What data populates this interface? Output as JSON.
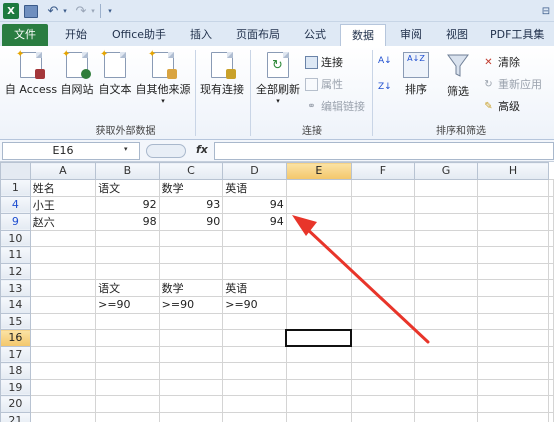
{
  "titlebar": {
    "app_icon": "X",
    "undo": "↶",
    "redo": "↷",
    "more": "▾",
    "drop": "▾",
    "right_text": "⊟"
  },
  "tabs": [
    {
      "label": "文件"
    },
    {
      "label": "开始"
    },
    {
      "label": "Office助手"
    },
    {
      "label": "插入"
    },
    {
      "label": "页面布局"
    },
    {
      "label": "公式"
    },
    {
      "label": "数据"
    },
    {
      "label": "审阅"
    },
    {
      "label": "视图"
    },
    {
      "label": "PDF工具集"
    }
  ],
  "ribbon": {
    "external": {
      "access": "自 Access",
      "web": "自网站",
      "text": "自文本",
      "other": "自其他来源",
      "existing": "现有连接",
      "group": "获取外部数据"
    },
    "connections": {
      "refresh_all": "全部刷新",
      "connections": "连接",
      "properties": "属性",
      "edit_links": "编辑链接",
      "group": "连接"
    },
    "sort_filter": {
      "sort": "排序",
      "filter": "筛选",
      "clear": "清除",
      "reapply": "重新应用",
      "advanced": "高级",
      "group": "排序和筛选",
      "az": "A↓Z",
      "za": "Z↓A",
      "az_top": "A↓",
      "za_bottom": "Z↓"
    }
  },
  "formula_bar": {
    "name_box": "E16",
    "fx": "fx",
    "formula": ""
  },
  "columns": [
    "A",
    "B",
    "C",
    "D",
    "E",
    "F",
    "G",
    "H"
  ],
  "rows": [
    {
      "num": "1",
      "cells": [
        "姓名",
        "语文",
        "数学",
        "英语",
        "",
        "",
        "",
        ""
      ]
    },
    {
      "num": "4",
      "cells": [
        "小王",
        "92",
        "93",
        "94",
        "",
        "",
        "",
        ""
      ]
    },
    {
      "num": "9",
      "cells": [
        "赵六",
        "98",
        "90",
        "94",
        "",
        "",
        "",
        ""
      ]
    },
    {
      "num": "10",
      "cells": [
        "",
        "",
        "",
        "",
        "",
        "",
        "",
        ""
      ]
    },
    {
      "num": "11",
      "cells": [
        "",
        "",
        "",
        "",
        "",
        "",
        "",
        ""
      ]
    },
    {
      "num": "12",
      "cells": [
        "",
        "",
        "",
        "",
        "",
        "",
        "",
        ""
      ]
    },
    {
      "num": "13",
      "cells": [
        "",
        "语文",
        "数学",
        "英语",
        "",
        "",
        "",
        ""
      ]
    },
    {
      "num": "14",
      "cells": [
        "",
        ">=90",
        ">=90",
        ">=90",
        "",
        "",
        "",
        ""
      ]
    },
    {
      "num": "15",
      "cells": [
        "",
        "",
        "",
        "",
        "",
        "",
        "",
        ""
      ]
    },
    {
      "num": "16",
      "cells": [
        "",
        "",
        "",
        "",
        "",
        "",
        "",
        ""
      ]
    },
    {
      "num": "17",
      "cells": [
        "",
        "",
        "",
        "",
        "",
        "",
        "",
        ""
      ]
    },
    {
      "num": "18",
      "cells": [
        "",
        "",
        "",
        "",
        "",
        "",
        "",
        ""
      ]
    },
    {
      "num": "19",
      "cells": [
        "",
        "",
        "",
        "",
        "",
        "",
        "",
        ""
      ]
    },
    {
      "num": "20",
      "cells": [
        "",
        "",
        "",
        "",
        "",
        "",
        "",
        ""
      ]
    },
    {
      "num": "21",
      "cells": [
        "",
        "",
        "",
        "",
        "",
        "",
        "",
        ""
      ]
    }
  ],
  "selection": {
    "row": "16",
    "col": "E"
  },
  "colors": {
    "arrow": "#e8352a",
    "file_tab": "#2a7d41",
    "selected_header": "#f3c66a"
  }
}
